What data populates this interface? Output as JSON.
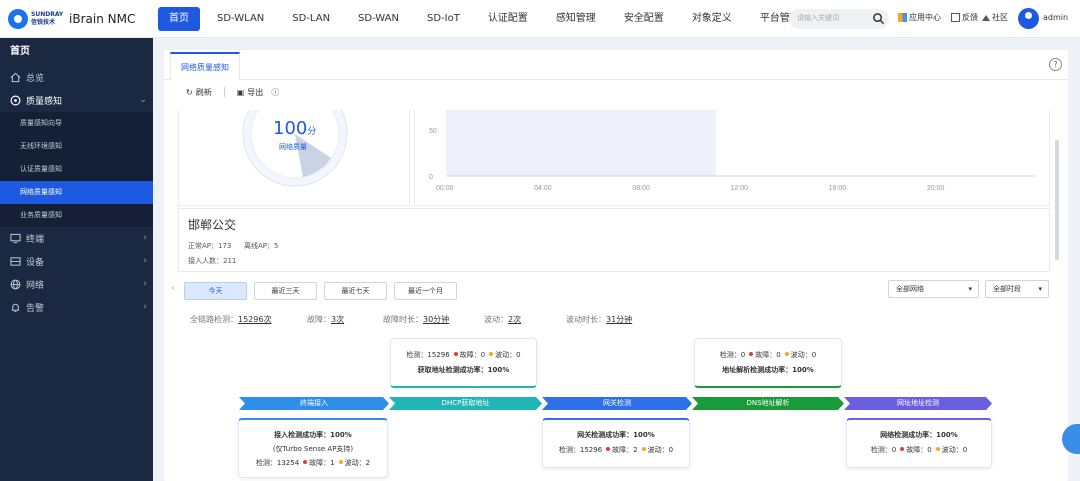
{
  "brand": {
    "logo_text": "SUNDRAY 信锐技术",
    "product": "iBrain NMC"
  },
  "nav": [
    {
      "label": "首页",
      "active": true
    },
    {
      "label": "SD-WLAN"
    },
    {
      "label": "SD-LAN"
    },
    {
      "label": "SD-WAN"
    },
    {
      "label": "SD-IoT"
    },
    {
      "label": "认证配置"
    },
    {
      "label": "感知管理"
    },
    {
      "label": "安全配置"
    },
    {
      "label": "对象定义"
    },
    {
      "label": "平台管理"
    }
  ],
  "search": {
    "placeholder": "请输入关键词"
  },
  "toolbar_right": {
    "app_center": "应用中心",
    "feedback": "反馈",
    "community": "社区",
    "user": "admin"
  },
  "sidebar": {
    "title": "首页",
    "items": [
      {
        "label": "总览"
      },
      {
        "label": "质量感知",
        "expanded": true,
        "children": [
          "质量感知向导",
          "无线环境感知",
          "认证质量感知",
          "网络质量感知",
          "业务质量感知"
        ],
        "active_child": "网络质量感知"
      },
      {
        "label": "终端"
      },
      {
        "label": "设备"
      },
      {
        "label": "网络"
      },
      {
        "label": "告警"
      }
    ]
  },
  "tab": {
    "label": "网络质量感知"
  },
  "actions": {
    "refresh": "刷新",
    "export": "导出"
  },
  "score": {
    "value": "100",
    "unit": "分",
    "label": "网络质量"
  },
  "chart_data": {
    "type": "area",
    "x": [
      "00:00",
      "04:00",
      "08:00",
      "12:00",
      "16:00",
      "20:00"
    ],
    "y_ticks": [
      "50",
      "0"
    ],
    "ylim": [
      0,
      50
    ],
    "highlight_range": [
      "00:00",
      "11:00"
    ]
  },
  "site": {
    "name": "邯郸公交",
    "online_ap": "正常AP：173",
    "offline_ap": "离线AP：5",
    "users": "接入人数：211"
  },
  "range_buttons": [
    {
      "label": "今天",
      "active": true
    },
    {
      "label": "最近三天"
    },
    {
      "label": "最近七天"
    },
    {
      "label": "最近一个月"
    }
  ],
  "filters": {
    "network": "全部网络",
    "period": "全部时段"
  },
  "summary": [
    {
      "label": "全链路检测：",
      "value": "15296次"
    },
    {
      "label": "故障：",
      "value": "3次"
    },
    {
      "label": "故障时长：",
      "value": "30分钟"
    },
    {
      "label": "波动：",
      "value": "2次"
    },
    {
      "label": "波动时长：",
      "value": "31分钟"
    }
  ],
  "stages": [
    {
      "label": "终端接入",
      "color": "#2f8fe8"
    },
    {
      "label": "DHCP获取地址",
      "color": "#21b5b5"
    },
    {
      "label": "网关检测",
      "color": "#2f6fe8"
    },
    {
      "label": "DNS地址解析",
      "color": "#1a9b3a"
    },
    {
      "label": "网址地址检测",
      "color": "#6a5fe0"
    }
  ],
  "boxes": [
    {
      "title": "接入检测成功率：100%",
      "sub": "(仅Turbo Sense AP支持)",
      "detect": "13254",
      "fault": "1",
      "wave": "2"
    },
    {
      "title": "获取地址检测成功率：100%",
      "detect": "15296",
      "fault": "0",
      "wave": "0"
    },
    {
      "title": "网关检测成功率：100%",
      "detect": "15296",
      "fault": "2",
      "wave": "0"
    },
    {
      "title": "地址解析检测成功率：100%",
      "detect": "0",
      "fault": "0",
      "wave": "0"
    },
    {
      "title": "网络检测成功率：100%",
      "detect": "0",
      "fault": "0",
      "wave": "0"
    }
  ],
  "labels": {
    "detect": "检测：",
    "fault": "故障：",
    "wave": "波动："
  }
}
